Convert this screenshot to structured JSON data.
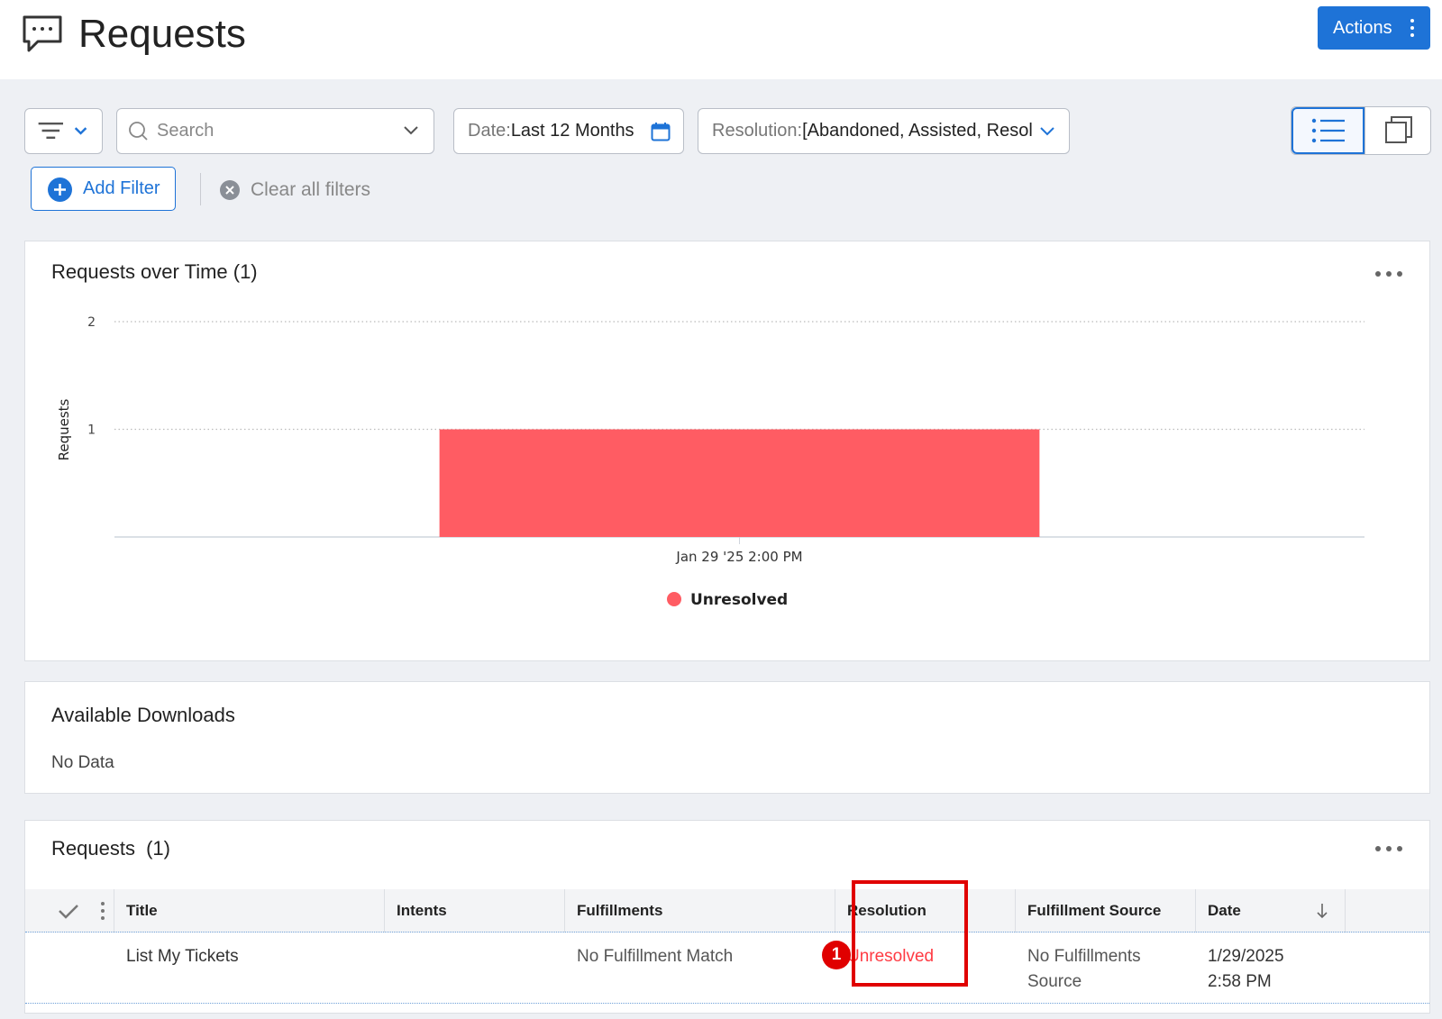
{
  "header": {
    "title": "Requests",
    "icon": "chat-bubble-icon",
    "actions_label": "Actions"
  },
  "toolbar": {
    "search_placeholder": "Search",
    "date_label": "Date:",
    "date_value": "Last 12 Months",
    "resolution_label": "Resolution:",
    "resolution_value": "[Abandoned, Assisted, Resol",
    "add_filter_label": "Add Filter",
    "clear_filters_label": "Clear all filters"
  },
  "chart_panel": {
    "title": "Requests over Time (1)"
  },
  "chart_data": {
    "type": "bar",
    "title": "Requests over Time (1)",
    "ylabel": "Requests",
    "xlabel": "",
    "categories": [
      "Jan 29 '25 2:00 PM"
    ],
    "series": [
      {
        "name": "Unresolved",
        "values": [
          1
        ],
        "color": "#ff5c63"
      }
    ],
    "yticks": [
      1,
      2
    ],
    "ylim": [
      0,
      2
    ],
    "grid": "dotted horizontal",
    "legend": "bottom-center"
  },
  "downloads_panel": {
    "title": "Available Downloads",
    "empty_text": "No Data"
  },
  "requests_panel": {
    "title": "Requests",
    "count": "(1)",
    "columns": [
      "Title",
      "Intents",
      "Fulfillments",
      "Resolution",
      "Fulfillment Source",
      "Date"
    ],
    "rows": [
      {
        "title": "List My Tickets",
        "intents": "",
        "fulfillments": "No Fulfillment Match",
        "resolution": "Unresolved",
        "fulfillment_source_1": "No Fulfillments",
        "fulfillment_source_2": "Source",
        "date_1": "1/29/2025",
        "date_2": "2:58 PM"
      }
    ],
    "annotation_badge": "1"
  },
  "colors": {
    "accent": "#1e73d7",
    "unresolved": "#ff5c63",
    "highlight": "#e00000"
  }
}
